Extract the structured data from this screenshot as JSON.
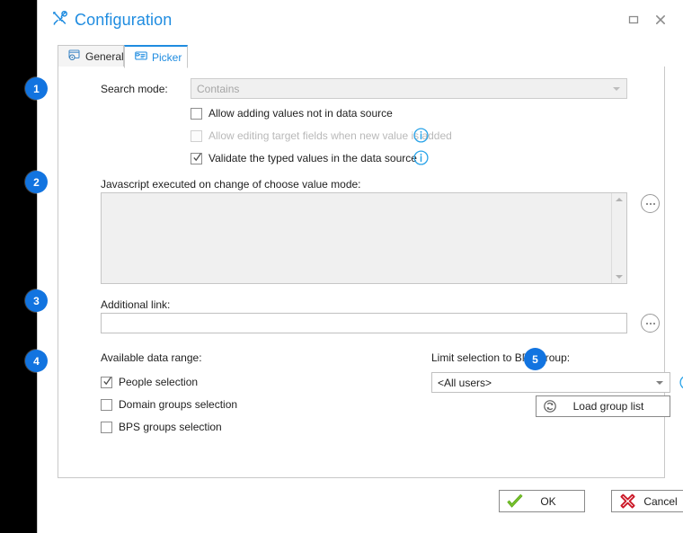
{
  "window": {
    "title": "Configuration",
    "title_icon": "tools-icon",
    "accent_color": "#1f8ce0",
    "badge_color": "#1274e0",
    "controls": [
      {
        "name": "maximize-button",
        "glyph": "maximize-icon"
      },
      {
        "name": "close-button",
        "glyph": "close-icon"
      }
    ]
  },
  "tabs": [
    {
      "label": "General",
      "icon": "general-tab-icon",
      "active": false
    },
    {
      "label": "Picker",
      "icon": "picker-tab-icon",
      "active": true
    }
  ],
  "form": {
    "search_mode": {
      "label": "Search mode:",
      "value": "Contains",
      "disabled": true
    },
    "checkboxes": [
      {
        "label": "Allow adding values not in data source",
        "checked": false,
        "disabled": false,
        "info": false
      },
      {
        "label": "Allow editing target fields when new value is added",
        "checked": false,
        "disabled": true,
        "info": true
      },
      {
        "label": "Validate the typed values in the data source",
        "checked": true,
        "disabled": false,
        "info": true
      }
    ],
    "javascript": {
      "label": "Javascript executed on change of choose value mode:",
      "value": "",
      "ellipsis_label": "..."
    },
    "additional_link": {
      "label": "Additional link:",
      "value": "",
      "ellipsis_label": "..."
    },
    "data_range": {
      "label": "Available data range:",
      "options": [
        {
          "label": "People selection",
          "checked": true
        },
        {
          "label": "Domain groups selection",
          "checked": false
        },
        {
          "label": "BPS groups selection",
          "checked": false
        }
      ]
    },
    "bps_group": {
      "label": "Limit selection to BPS group:",
      "value": "<All users>",
      "load_button": "Load group list",
      "load_button_icon": "refresh-icon"
    }
  },
  "footer": {
    "ok_label": "OK",
    "ok_icon": "checkmark-icon",
    "cancel_label": "Cancel",
    "cancel_icon": "red-x-icon"
  },
  "callouts": [
    {
      "number": "1"
    },
    {
      "number": "2"
    },
    {
      "number": "3"
    },
    {
      "number": "4"
    },
    {
      "number": "5"
    }
  ]
}
